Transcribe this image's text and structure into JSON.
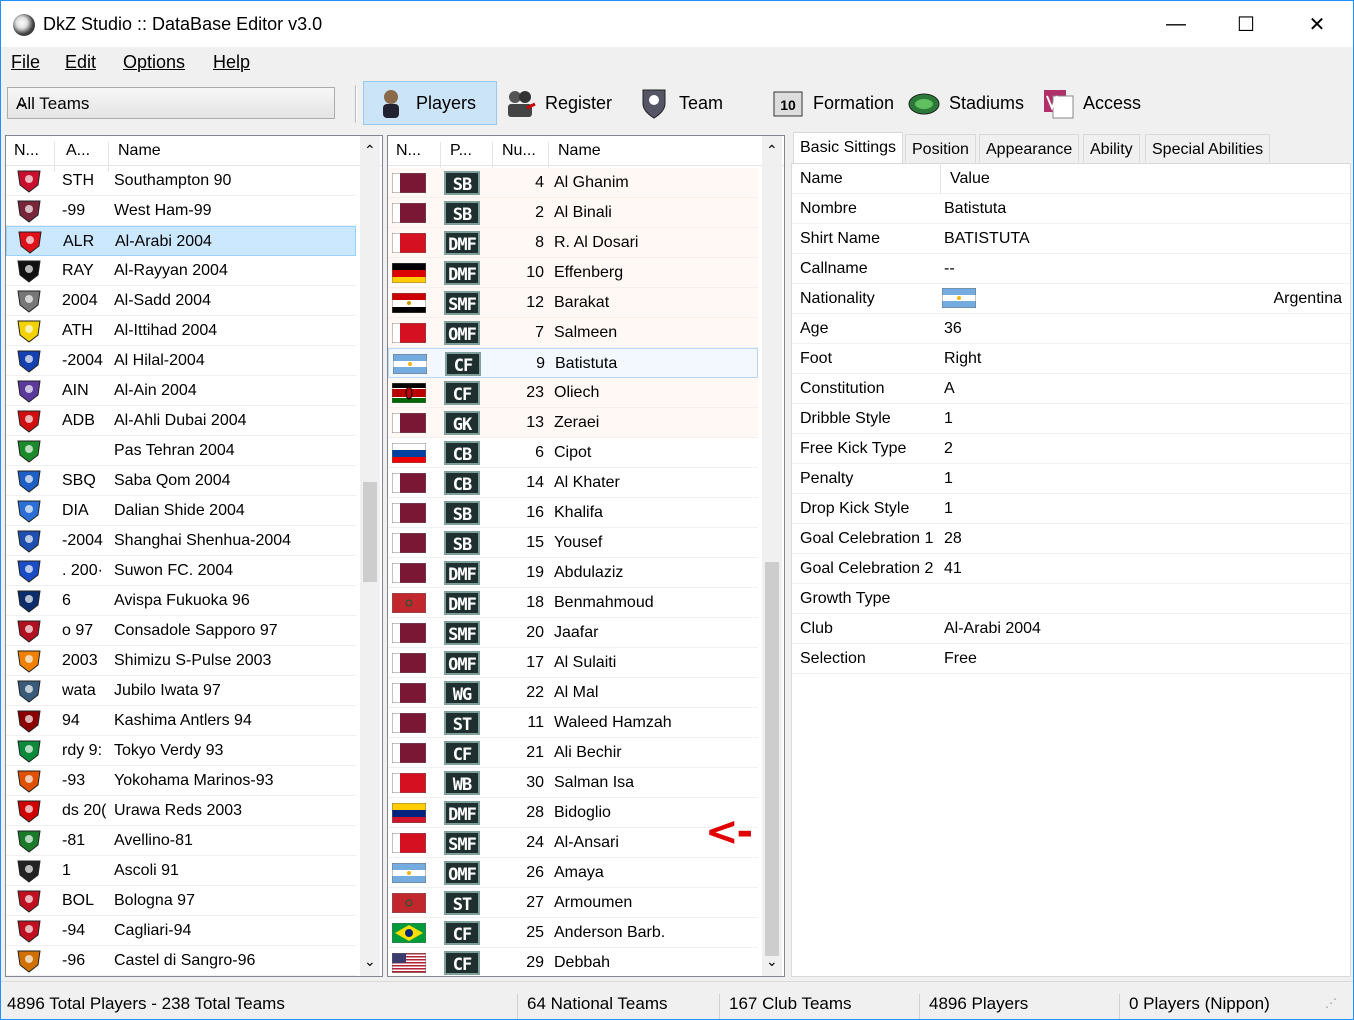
{
  "window": {
    "title": "DkZ Studio :: DataBase Editor v3.0",
    "minimize": "—",
    "maximize": "☐",
    "close": "✕"
  },
  "menu": [
    "File",
    "Edit",
    "Options",
    "Help"
  ],
  "toolbar": {
    "filter_value": "All Teams",
    "buttons": [
      {
        "label": "Players",
        "icon": "player-icon"
      },
      {
        "label": "Register",
        "icon": "register-icon"
      },
      {
        "label": "Team",
        "icon": "team-icon"
      },
      {
        "label": "Formation",
        "icon": "formation-icon"
      },
      {
        "label": "Stadiums",
        "icon": "stadium-icon"
      },
      {
        "label": "Access",
        "icon": "access-icon"
      }
    ]
  },
  "teams": {
    "headers": [
      "N...",
      "A...",
      "Name"
    ],
    "rows": [
      {
        "abbr": "STH",
        "name": "Southampton 90",
        "color": "#c8102e"
      },
      {
        "abbr": "-99",
        "name": "West Ham-99",
        "color": "#7a263a"
      },
      {
        "abbr": "ALR",
        "name": "Al-Arabi 2004",
        "color": "#e0101a",
        "selected": true
      },
      {
        "abbr": "RAY",
        "name": "Al-Rayyan 2004",
        "color": "#111111"
      },
      {
        "abbr": "2004",
        "name": "Al-Sadd 2004",
        "color": "#777777"
      },
      {
        "abbr": "ATH",
        "name": "Al-Ittihad 2004",
        "color": "#f2d200"
      },
      {
        "abbr": "-2004",
        "name": "Al Hilal-2004",
        "color": "#1540b0"
      },
      {
        "abbr": "AIN",
        "name": "Al-Ain 2004",
        "color": "#5b3a9c"
      },
      {
        "abbr": "ADB",
        "name": "Al-Ahli Dubai 2004",
        "color": "#d01010"
      },
      {
        "abbr": "",
        "name": "Pas Tehran 2004",
        "color": "#1b8a2b"
      },
      {
        "abbr": "SBQ",
        "name": "Saba Qom 2004",
        "color": "#1d5fc4"
      },
      {
        "abbr": "DIA",
        "name": "Dalian Shide 2004",
        "color": "#2b6fd6"
      },
      {
        "abbr": "-2004",
        "name": "Shanghai Shenhua-2004",
        "color": "#1e4fb0"
      },
      {
        "abbr": ". 200·",
        "name": "Suwon FC. 2004",
        "color": "#1a4cc6"
      },
      {
        "abbr": "6",
        "name": "Avispa Fukuoka 96",
        "color": "#0c2d6b"
      },
      {
        "abbr": "o 97",
        "name": "Consadole Sapporo 97",
        "color": "#b01020"
      },
      {
        "abbr": "2003",
        "name": "Shimizu S-Pulse 2003",
        "color": "#f08000"
      },
      {
        "abbr": "wata",
        "name": "Jubilo Iwata 97",
        "color": "#3a5a7a"
      },
      {
        "abbr": "94",
        "name": "Kashima Antlers 94",
        "color": "#8b0000"
      },
      {
        "abbr": "rdy 9:",
        "name": "Tokyo Verdy 93",
        "color": "#0a8a3a"
      },
      {
        "abbr": "-93",
        "name": "Yokohama Marinos-93",
        "color": "#e05000"
      },
      {
        "abbr": "ds 20(",
        "name": "Urawa Reds 2003",
        "color": "#d00000"
      },
      {
        "abbr": "-81",
        "name": "Avellino-81",
        "color": "#1a7a2a"
      },
      {
        "abbr": "1",
        "name": "Ascoli 91",
        "color": "#222222"
      },
      {
        "abbr": "BOL",
        "name": "Bologna 97",
        "color": "#c01020"
      },
      {
        "abbr": "-94",
        "name": "Cagliari-94",
        "color": "#c01020"
      },
      {
        "abbr": "-96",
        "name": "Castel di Sangro-96",
        "color": "#d07000"
      }
    ]
  },
  "players": {
    "headers": [
      "N...",
      "P...",
      "Nu...",
      "Name"
    ],
    "rows": [
      {
        "flag": "qatar",
        "pos": "SB",
        "num": "4",
        "name": "Al Ghanim"
      },
      {
        "flag": "qatar",
        "pos": "SB",
        "num": "2",
        "name": "Al Binali"
      },
      {
        "flag": "bahrain",
        "pos": "DMF",
        "num": "8",
        "name": "R. Al Dosari"
      },
      {
        "flag": "germany",
        "pos": "DMF",
        "num": "10",
        "name": "Effenberg"
      },
      {
        "flag": "egypt",
        "pos": "SMF",
        "num": "12",
        "name": "Barakat"
      },
      {
        "flag": "bahrain",
        "pos": "OMF",
        "num": "7",
        "name": "Salmeen"
      },
      {
        "flag": "argentina",
        "pos": "CF",
        "num": "9",
        "name": "Batistuta",
        "selected": true
      },
      {
        "flag": "kenya",
        "pos": "CF",
        "num": "23",
        "name": "Oliech"
      },
      {
        "flag": "qatar",
        "pos": "GK",
        "num": "13",
        "name": "Zeraei"
      },
      {
        "flag": "slovenia",
        "pos": "CB",
        "num": "6",
        "name": "Cipot"
      },
      {
        "flag": "qatar",
        "pos": "CB",
        "num": "14",
        "name": "Al Khater"
      },
      {
        "flag": "qatar",
        "pos": "SB",
        "num": "16",
        "name": "Khalifa"
      },
      {
        "flag": "qatar",
        "pos": "SB",
        "num": "15",
        "name": "Yousef"
      },
      {
        "flag": "qatar",
        "pos": "DMF",
        "num": "19",
        "name": "Abdulaziz"
      },
      {
        "flag": "morocco",
        "pos": "DMF",
        "num": "18",
        "name": "Benmahmoud"
      },
      {
        "flag": "qatar",
        "pos": "SMF",
        "num": "20",
        "name": "Jaafar"
      },
      {
        "flag": "qatar",
        "pos": "OMF",
        "num": "17",
        "name": "Al Sulaiti"
      },
      {
        "flag": "qatar",
        "pos": "WG",
        "num": "22",
        "name": "Al Mal"
      },
      {
        "flag": "qatar",
        "pos": "ST",
        "num": "11",
        "name": "Waleed Hamzah"
      },
      {
        "flag": "qatar",
        "pos": "CF",
        "num": "21",
        "name": "Ali Bechir"
      },
      {
        "flag": "bahrain",
        "pos": "WB",
        "num": "30",
        "name": "Salman Isa"
      },
      {
        "flag": "venezuela",
        "pos": "DMF",
        "num": "28",
        "name": "Bidoglio"
      },
      {
        "flag": "bahrain",
        "pos": "SMF",
        "num": "24",
        "name": "Al-Ansari"
      },
      {
        "flag": "argentina",
        "pos": "OMF",
        "num": "26",
        "name": "Amaya"
      },
      {
        "flag": "morocco",
        "pos": "ST",
        "num": "27",
        "name": "Armoumen"
      },
      {
        "flag": "brazil",
        "pos": "CF",
        "num": "25",
        "name": "Anderson Barb."
      },
      {
        "flag": "usa",
        "pos": "CF",
        "num": "29",
        "name": "Debbah"
      }
    ]
  },
  "annotation_arrow": "<-",
  "detail": {
    "tabs": [
      "Basic Sittings",
      "Position",
      "Appearance",
      "Ability",
      "Special Abilities"
    ],
    "headers": [
      "Name",
      "Value"
    ],
    "rows": [
      {
        "key": "Nombre",
        "value": "Batistuta"
      },
      {
        "key": "Shirt Name",
        "value": "BATISTUTA"
      },
      {
        "key": "Callname",
        "value": "--"
      },
      {
        "key": "Nationality",
        "value": "Argentina",
        "flag": "argentina"
      },
      {
        "key": "Age",
        "value": "36"
      },
      {
        "key": "Foot",
        "value": "Right"
      },
      {
        "key": "Constitution",
        "value": "A"
      },
      {
        "key": "Dribble Style",
        "value": "1"
      },
      {
        "key": "Free Kick Type",
        "value": "2"
      },
      {
        "key": "Penalty",
        "value": "1"
      },
      {
        "key": "Drop Kick Style",
        "value": "1"
      },
      {
        "key": "Goal Celebration 1",
        "value": "28"
      },
      {
        "key": "Goal Celebration 2",
        "value": "41"
      },
      {
        "key": "Growth Type",
        "value": ""
      },
      {
        "key": "Club",
        "value": "Al-Arabi 2004"
      },
      {
        "key": "Selection",
        "value": "Free"
      }
    ]
  },
  "status": [
    "4896 Total Players  -  238 Total Teams",
    "64 National Teams",
    "167 Club Teams",
    "4896 Players",
    "0 Players (Nippon)"
  ]
}
